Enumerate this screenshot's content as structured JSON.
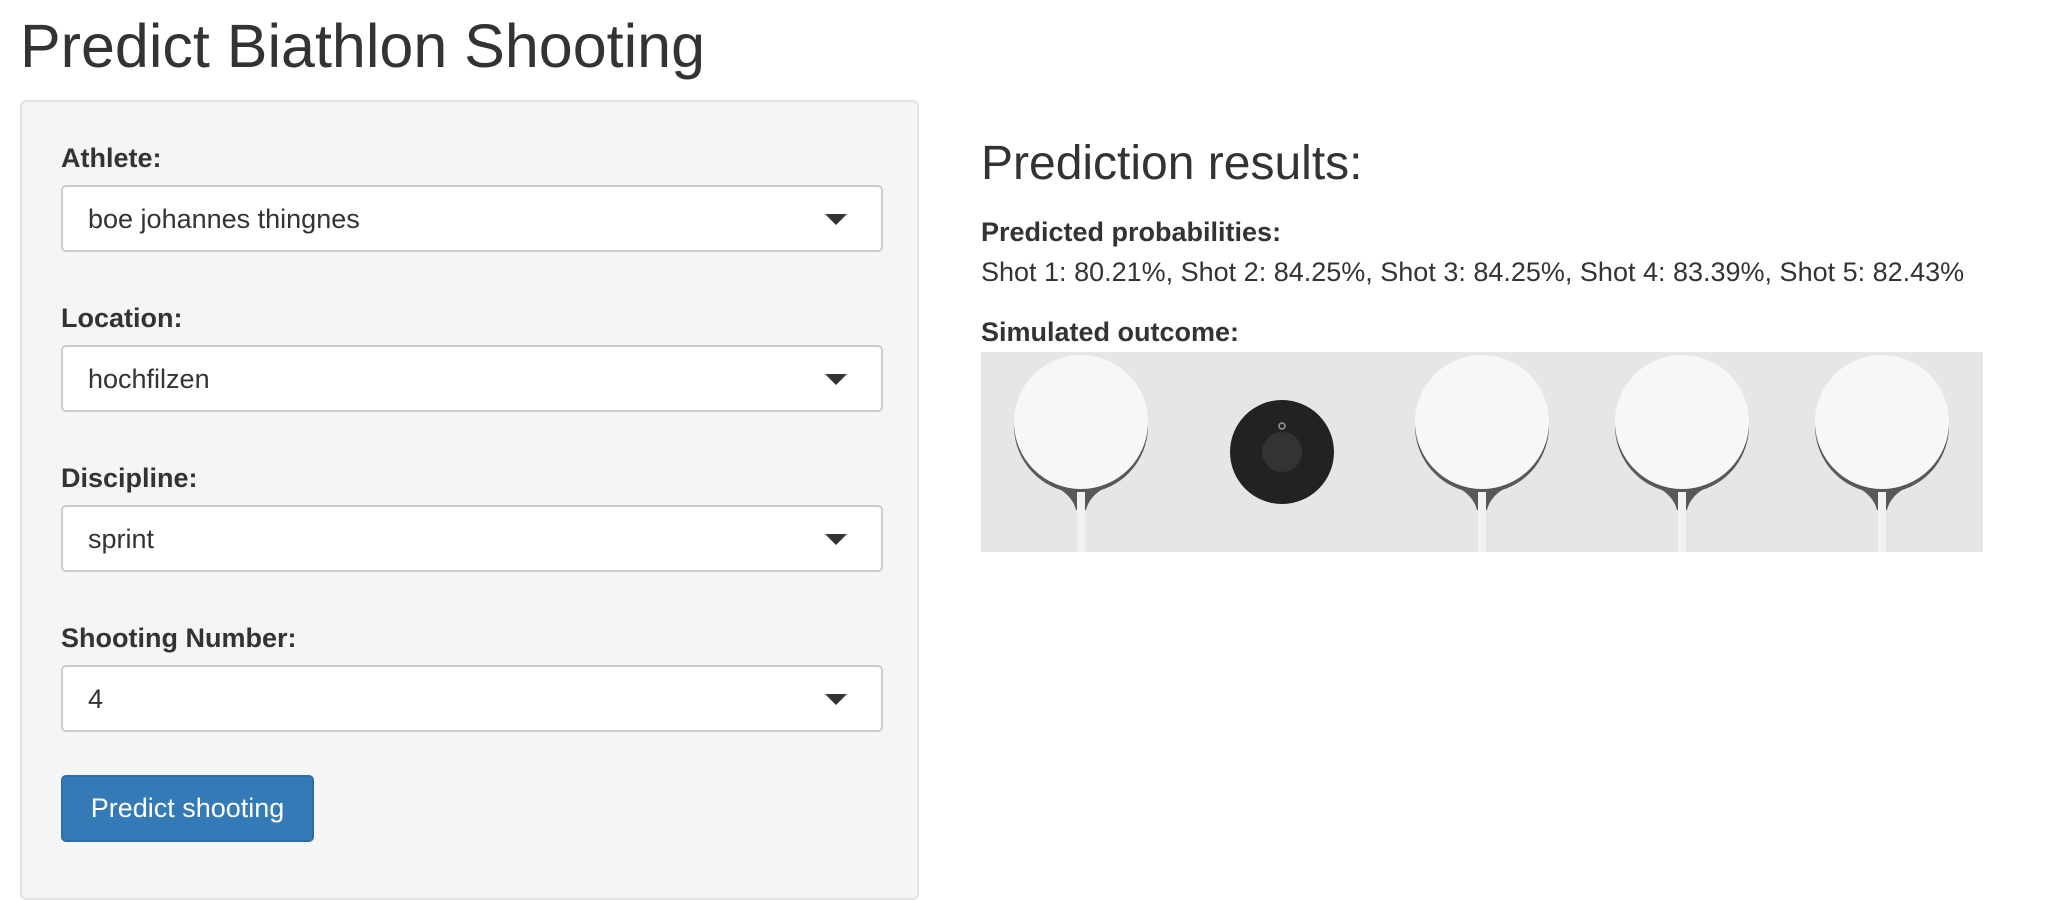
{
  "page": {
    "title": "Predict Biathlon Shooting"
  },
  "form": {
    "athlete": {
      "label": "Athlete:",
      "value": "boe johannes thingnes"
    },
    "location": {
      "label": "Location:",
      "value": "hochfilzen"
    },
    "discipline": {
      "label": "Discipline:",
      "value": "sprint"
    },
    "shooting_number": {
      "label": "Shooting Number:",
      "value": "4"
    },
    "predict_button": "Predict shooting"
  },
  "results": {
    "title": "Prediction results:",
    "probabilities_label": "Predicted probabilities:",
    "probabilities_text": "Shot 1: 80.21%, Shot 2: 84.25%, Shot 3: 84.25%, Shot 4: 83.39%, Shot 5: 82.43%",
    "probabilities": [
      80.21,
      84.25,
      84.25,
      83.39,
      82.43
    ],
    "outcome_label": "Simulated outcome:",
    "outcome": [
      "hit",
      "miss",
      "hit",
      "hit",
      "hit"
    ]
  },
  "colors": {
    "primary": "#337ab7",
    "target_miss": "#222222",
    "target_hit": "#f7f7f7",
    "strip_bg": "#e6e6e4"
  }
}
